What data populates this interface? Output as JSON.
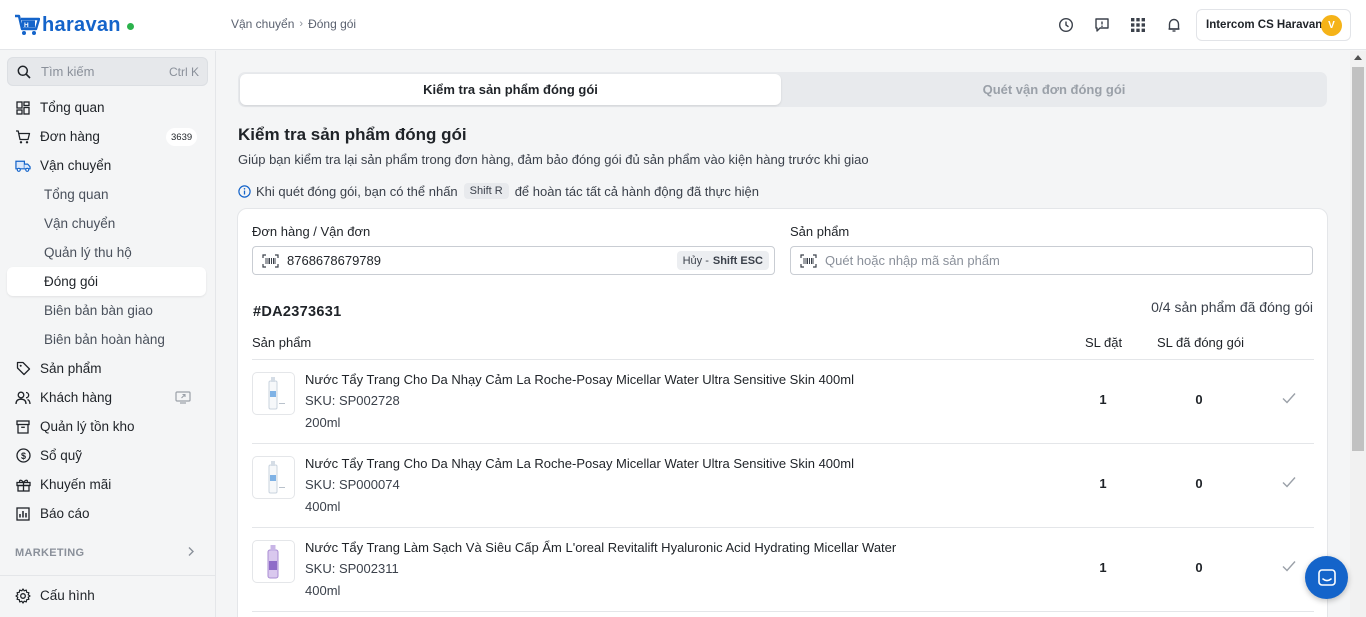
{
  "app": {
    "logo_text": "haravan",
    "brand_color": "#1464ca"
  },
  "breadcrumb": {
    "parent": "Vận chuyển",
    "current": "Đóng gói"
  },
  "account": {
    "name": "Intercom CS Haravan",
    "avatar_letter": "V"
  },
  "sidebar": {
    "search_placeholder": "Tìm kiếm",
    "search_shortcut": "Ctrl K",
    "items": [
      {
        "label": "Tổng quan",
        "icon": "dashboard-icon"
      },
      {
        "label": "Đơn hàng",
        "icon": "cart-icon",
        "badge": "3639"
      },
      {
        "label": "Vận chuyển",
        "icon": "truck-icon"
      }
    ],
    "sub_items": [
      {
        "label": "Tổng quan"
      },
      {
        "label": "Vận chuyển"
      },
      {
        "label": "Quản lý thu hộ"
      },
      {
        "label": "Đóng gói"
      },
      {
        "label": "Biên bản bàn giao"
      },
      {
        "label": "Biên bản hoàn hàng"
      }
    ],
    "items2": [
      {
        "label": "Sản phẩm",
        "icon": "tag-icon"
      },
      {
        "label": "Khách hàng",
        "icon": "users-icon"
      },
      {
        "label": "Quản lý tồn kho",
        "icon": "box-icon"
      },
      {
        "label": "Sổ quỹ",
        "icon": "dollar-icon"
      },
      {
        "label": "Khuyến mãi",
        "icon": "gift-icon"
      },
      {
        "label": "Báo cáo",
        "icon": "chart-icon"
      }
    ],
    "marketing_label": "MARKETING",
    "config_label": "Cấu hình"
  },
  "tabs": {
    "active": "Kiểm tra sản phẩm đóng gói",
    "inactive": "Quét vận đơn đóng gói"
  },
  "page": {
    "title": "Kiểm tra sản phẩm đóng gói",
    "description": "Giúp bạn kiểm tra lại sản phẩm trong đơn hàng, đảm bảo đóng gói đủ sản phẩm vào kiện hàng trước khi giao",
    "hint_before": "Khi quét đóng gói, bạn có thể nhấn",
    "hint_key": "Shift R",
    "hint_after": "để hoàn tác tất cả hành động đã thực hiện"
  },
  "form": {
    "order_label": "Đơn hàng / Vận đơn",
    "order_value": "8768678679789",
    "cancel_label": "Hủy -",
    "cancel_key": "Shift ESC",
    "product_label": "Sản phẩm",
    "product_placeholder": "Quét hoặc nhập mã sản phẩm"
  },
  "order": {
    "code": "#DA2373631",
    "progress": "0/4 sản phẩm đã đóng gói",
    "columns": {
      "product": "Sản phẩm",
      "ordered": "SL đặt",
      "packed": "SL đã đóng gói"
    },
    "rows": [
      {
        "name": "Nước Tẩy Trang Cho Da Nhạy Cảm La Roche-Posay Micellar Water Ultra Sensitive Skin 400ml",
        "sku": "SKU: SP002728",
        "variant": "200ml",
        "ordered": "1",
        "packed": "0"
      },
      {
        "name": "Nước Tẩy Trang Cho Da Nhạy Cảm La Roche-Posay Micellar Water Ultra Sensitive Skin 400ml",
        "sku": "SKU: SP000074",
        "variant": "400ml",
        "ordered": "1",
        "packed": "0"
      },
      {
        "name": "Nước Tẩy Trang Làm Sạch Và Siêu Cấp Ẩm L'oreal Revitalift Hyaluronic Acid Hydrating Micellar Water",
        "sku": "SKU: SP002311",
        "variant": "400ml",
        "ordered": "1",
        "packed": "0"
      }
    ]
  }
}
